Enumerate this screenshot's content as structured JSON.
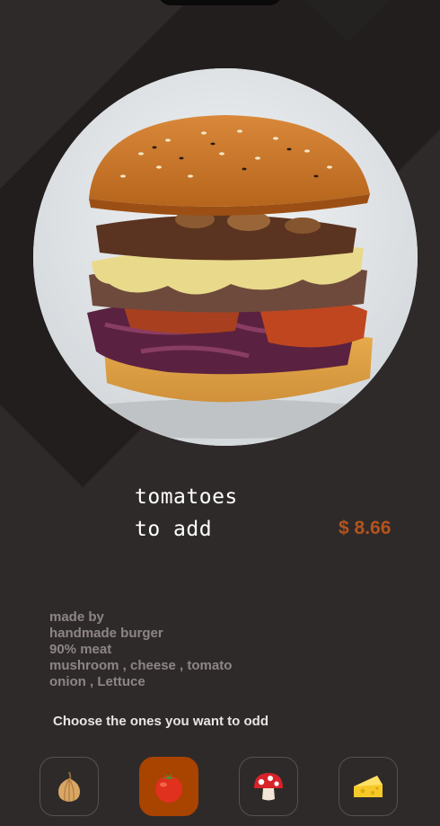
{
  "product": {
    "title_line1": "tomatoes",
    "title_line2": "to add",
    "price": "$ 8.66"
  },
  "description": {
    "lines": [
      "made by",
      "handmade burger",
      "90% meat",
      "mushroom , cheese , tomato",
      "onion , Lettuce"
    ]
  },
  "ingredients": {
    "prompt": "Choose the ones you want to odd",
    "options": [
      {
        "icon": "onion-icon",
        "selected": false
      },
      {
        "icon": "tomato-icon",
        "selected": true
      },
      {
        "icon": "mushroom-icon",
        "selected": false
      },
      {
        "icon": "cheese-icon",
        "selected": false
      }
    ]
  },
  "colors": {
    "background": "#2f2a2a",
    "accent": "#a94300",
    "price": "#b3541c"
  }
}
